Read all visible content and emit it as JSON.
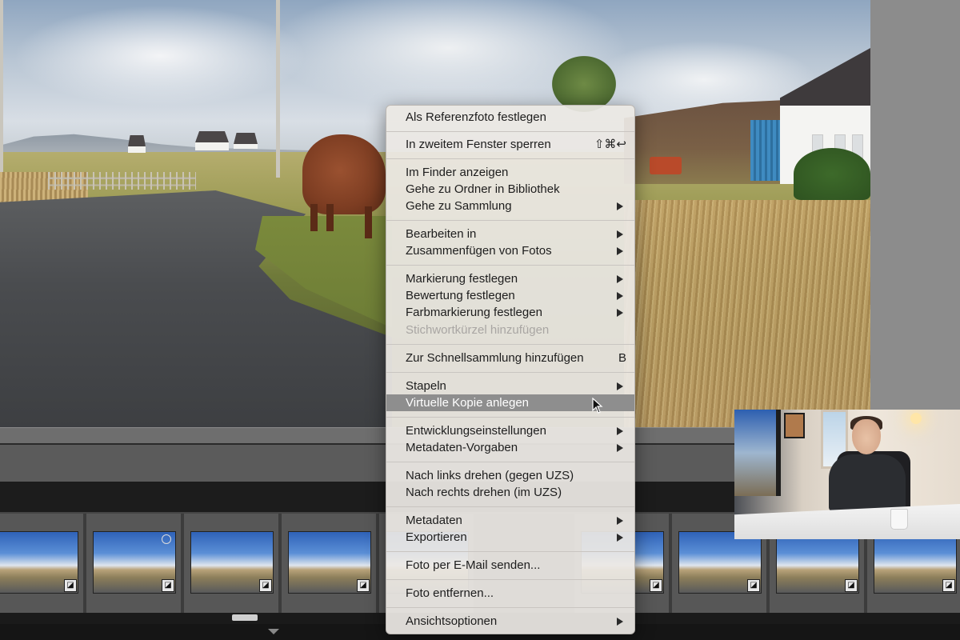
{
  "context_menu": {
    "items": [
      {
        "label": "Als Referenzfoto festlegen"
      },
      {
        "label": "In zweitem Fenster sperren",
        "shortcut": "⇧⌘↩"
      },
      {
        "label": "Im Finder anzeigen"
      },
      {
        "label": "Gehe zu Ordner in Bibliothek"
      },
      {
        "label": "Gehe zu Sammlung",
        "submenu": true
      },
      {
        "label": "Bearbeiten in",
        "submenu": true
      },
      {
        "label": "Zusammenfügen von Fotos",
        "submenu": true
      },
      {
        "label": "Markierung festlegen",
        "submenu": true
      },
      {
        "label": "Bewertung festlegen",
        "submenu": true
      },
      {
        "label": "Farbmarkierung festlegen",
        "submenu": true
      },
      {
        "label": "Stichwortkürzel hinzufügen",
        "disabled": true
      },
      {
        "label": "Zur Schnellsammlung hinzufügen",
        "shortcut": "B"
      },
      {
        "label": "Stapeln",
        "submenu": true
      },
      {
        "label": "Virtuelle Kopie anlegen",
        "highlighted": true
      },
      {
        "label": "Entwicklungseinstellungen",
        "submenu": true
      },
      {
        "label": "Metadaten-Vorgaben",
        "submenu": true
      },
      {
        "label": "Nach links drehen (gegen UZS)"
      },
      {
        "label": "Nach rechts drehen (im UZS)"
      },
      {
        "label": "Metadaten",
        "submenu": true
      },
      {
        "label": "Exportieren",
        "submenu": true
      },
      {
        "label": "Foto per E-Mail senden..."
      },
      {
        "label": "Foto entfernen..."
      },
      {
        "label": "Ansichtsoptionen",
        "submenu": true
      }
    ]
  },
  "filmstrip": {
    "thumbnails": [
      {
        "name": "thumb-1",
        "badge": "virtual-copy-icon"
      },
      {
        "name": "thumb-2",
        "badge": "virtual-copy-icon",
        "selected_indicator": "circle-icon"
      },
      {
        "name": "thumb-3",
        "badge": "virtual-copy-icon"
      },
      {
        "name": "thumb-4",
        "badge": "virtual-copy-icon"
      },
      {
        "name": "thumb-5",
        "badge": "virtual-copy-icon"
      },
      {
        "name": "thumb-6",
        "badge": "virtual-copy-icon"
      },
      {
        "name": "thumb-7",
        "badge": "virtual-copy-icon"
      },
      {
        "name": "thumb-8",
        "badge": "virtual-copy-icon"
      },
      {
        "name": "thumb-9",
        "badge": "virtual-copy-icon"
      }
    ]
  },
  "colors": {
    "menu_background": "#ece8e4",
    "menu_highlight": "#8e8e8e",
    "menu_text": "#1d1d1d",
    "menu_disabled_text": "#a9a6a3",
    "app_dark": "#1e1e1e",
    "side_panel": "#8c8c8c"
  }
}
